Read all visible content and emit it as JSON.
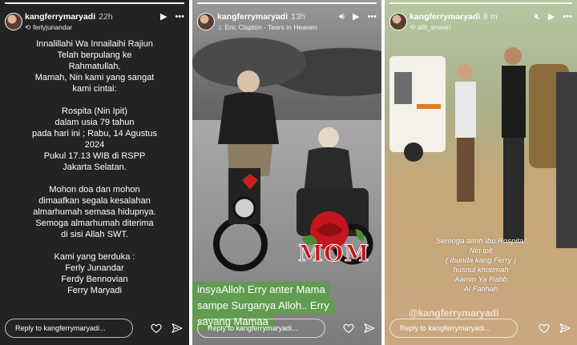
{
  "stories": [
    {
      "username": "kangferrymaryadi",
      "time": "22h",
      "subline": "ferlyjunandar",
      "progress": 1.0,
      "lines": [
        "Innalillahi Wa Innailaihi Rajiun",
        "Telah berpulang ke",
        "Rahmatullah,",
        "Mamah, Nin kami yang sangat",
        "kami cintai:",
        "",
        "Rospita (Nin Ipit)",
        "dalam usia 79 tahun",
        "pada hari ini ; Rabu, 14 Agustus",
        "2024",
        "Pukul 17.13 WIB di RSPP",
        "Jakarta Selatan.",
        "",
        "Mohon doa dan mohon",
        "dimaafkan segala kesalahan",
        "almarhumah semasa hidupnya.",
        "Semoga almarhumah diterima",
        "di sisi Allah SWT.",
        "",
        "Kami yang berduka :",
        "Ferly Junandar",
        "Ferdy Bennovian",
        "Ferry Maryadi"
      ],
      "reply_placeholder": "Reply to kangferrymaryadi..."
    },
    {
      "username": "kangferrymaryadi",
      "time": "13h",
      "subline": "Eric Clapton · Tears in Heaven",
      "progress": 1.0,
      "sticker_text": "MOM",
      "caption_lines": [
        "insyaAlloh Erry anter Mama",
        "sampe Surganya Alloh.. Erry",
        "sayang Mamaa"
      ],
      "reply_placeholder": "Reply to kangferrymaryadi..."
    },
    {
      "username": "kangferrymaryadi",
      "time": "8 m",
      "subline": "afif_anwari",
      "progress": 1.0,
      "caption_lines": [
        "Semoga almh Ibu Rospita/",
        "Nin ipit",
        "( ibunda kang Ferry )",
        "husnul khotimah",
        "Aamin Ya Rabb",
        "Al Fatihah"
      ],
      "watermark": "@kangferrymaryadi",
      "reply_placeholder": "Reply to kangferrymaryadi..."
    }
  ],
  "icons": {
    "play": "play-icon",
    "more": "more-icon",
    "sound": "sound-icon",
    "heart": "heart-icon",
    "send": "send-icon"
  },
  "colors": {
    "caption_bg": "#5aa046",
    "panel1_bg": "#232323"
  }
}
